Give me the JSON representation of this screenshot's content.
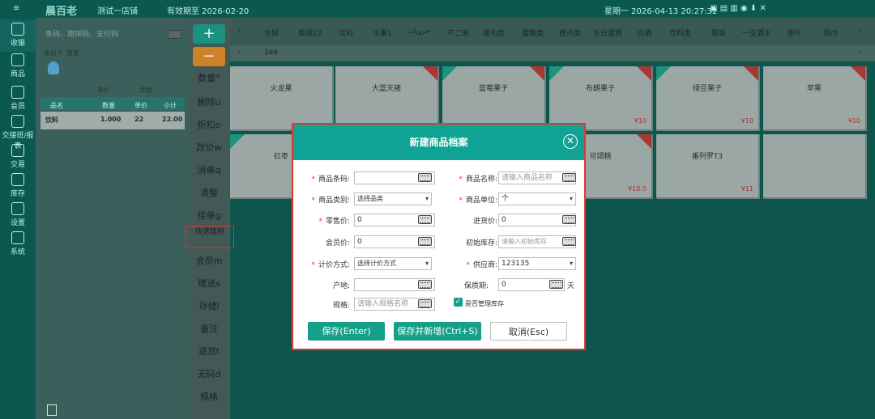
{
  "topbar": {
    "brand": "晨百老",
    "store": "测试一店铺",
    "expiry": "有效期至 2026-02-20",
    "clock": "星期一 2026-04-13 20:27:32"
  },
  "sidebar": {
    "items": [
      {
        "label": "收银"
      },
      {
        "label": "商品"
      },
      {
        "label": "会员"
      },
      {
        "label": "交接班/报表"
      },
      {
        "label": "交易"
      },
      {
        "label": "库存"
      },
      {
        "label": "设置"
      },
      {
        "label": "系统"
      }
    ]
  },
  "cart": {
    "search_placeholder": "条码、简拼码、支付码",
    "member_label": "会员卡",
    "member_value": "散客",
    "price_label": "单价",
    "amount_label": "金额",
    "col_name": "品名",
    "col_qty": "数量",
    "col_price": "单价",
    "col_sub": "小计",
    "row": {
      "name": "饮料",
      "qty": "1.000",
      "price": "22",
      "sub": "22.00"
    }
  },
  "ops": {
    "plus": "+",
    "minus": "−",
    "items": [
      "数量*",
      "删除u",
      "折扣o",
      "改价w",
      "消单q",
      "清整",
      "挂单g",
      "快速建档",
      "会员m",
      "赠送s",
      "存储l",
      "备注",
      "退货t",
      "无码d",
      "规格"
    ]
  },
  "categories": [
    "生鲜",
    "香烟22",
    "饮料",
    "水果1",
    "ﺣﺮﻭﻳﺎﺕ",
    "不二来",
    "面包类",
    "蛋糕类",
    "西点类",
    "生日蛋糕",
    "白酒",
    "饮料类",
    "服装",
    "一支酒水",
    "茶叶",
    "烟巾"
  ],
  "subtab": "1ea",
  "products": [
    {
      "name": "火龙果",
      "price": ""
    },
    {
      "name": "大蓝天猪",
      "price": ""
    },
    {
      "name": "蓝莓果子",
      "price": ""
    },
    {
      "name": "布朗果子",
      "price": "¥10"
    },
    {
      "name": "绿豆果子",
      "price": "¥10"
    },
    {
      "name": "苹果",
      "price": "¥10"
    },
    {
      "name": "红枣",
      "price": ""
    },
    {
      "name": "",
      "price": ""
    },
    {
      "name": "",
      "price": ""
    },
    {
      "name": "可颂糕",
      "price": "¥10.5"
    },
    {
      "name": "番列罗T3",
      "price": "¥11"
    },
    {
      "name": "",
      "price": ""
    }
  ],
  "dialog": {
    "title": "新建商品档案",
    "close": "✕",
    "barcode_label": "商品条码:",
    "name_label": "商品名称:",
    "name_placeholder": "请输入商品名称",
    "category_label": "商品类别:",
    "category_value": "选择品类",
    "unit_label": "商品单位:",
    "unit_value": "个",
    "retail_label": "零售价:",
    "retail_value": "0",
    "purchase_label": "进货价:",
    "purchase_value": "0",
    "member_label": "会员价:",
    "member_value": "0",
    "stock_label": "初始库存:",
    "stock_placeholder": "请输入初始库存",
    "pricing_label": "计价方式:",
    "pricing_value": "选择计价方式",
    "supplier_label": "供应商:",
    "supplier_value": "123135",
    "origin_label": "产地:",
    "shelf_label": "保质期:",
    "shelf_value": "0",
    "shelf_unit": "天",
    "spec_label": "规格:",
    "spec_placeholder": "请输入规格名称",
    "manage_stock": "是否管理库存",
    "save": "保存(Enter)",
    "save_new": "保存并新增(Ctrl+S)",
    "cancel": "取消(Esc)"
  }
}
